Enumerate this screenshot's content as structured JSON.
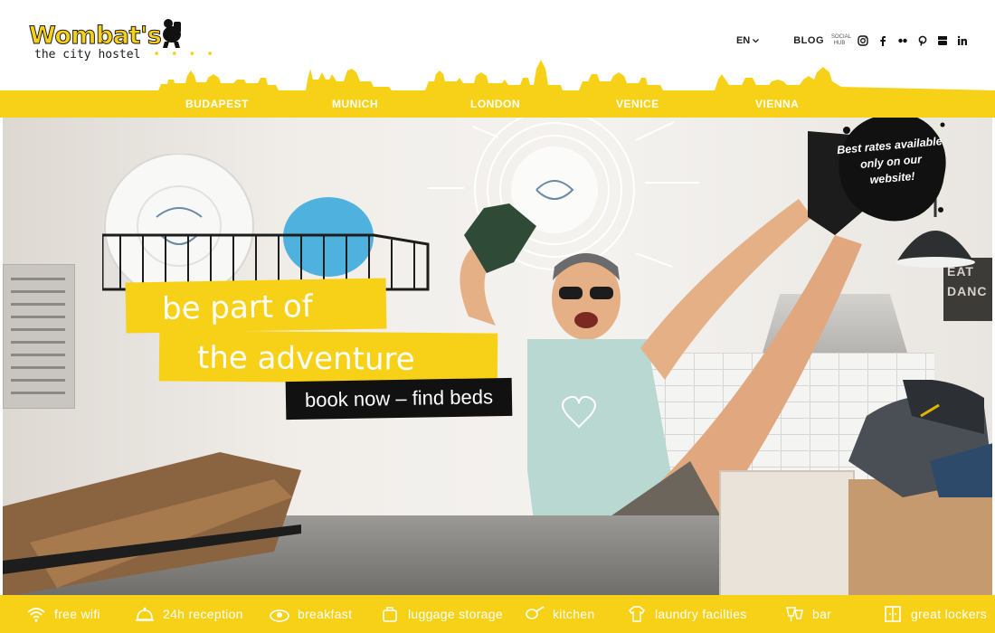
{
  "brand": {
    "logo_main": "Wombat's",
    "logo_sub": "the city hostel",
    "logo_dots": "• • • •"
  },
  "topnav": {
    "language": "EN",
    "blog_label": "BLOG",
    "social_hub": "SOCIAL HUB",
    "social_icons": [
      "instagram-icon",
      "facebook-icon",
      "flickr-icon",
      "pinterest-icon",
      "youtube-icon",
      "linkedin-icon"
    ]
  },
  "cities": [
    "BUDAPEST",
    "MUNICH",
    "LONDON",
    "VENICE",
    "VIENNA"
  ],
  "hero": {
    "headline_line1": "be part of",
    "headline_line2": "the adventure",
    "cta_label": "book now – find beds",
    "badge_text": "Best rates available only on our website!",
    "sign_text_1": "EAT",
    "sign_text_2": "DANC"
  },
  "amenities": [
    {
      "label": "free wifi",
      "icon": "wifi-icon"
    },
    {
      "label": "24h reception",
      "icon": "reception-bell-icon"
    },
    {
      "label": "breakfast",
      "icon": "breakfast-icon"
    },
    {
      "label": "luggage storage",
      "icon": "luggage-icon"
    },
    {
      "label": "kitchen",
      "icon": "kitchen-icon"
    },
    {
      "label": "laundry facilties",
      "icon": "laundry-icon"
    },
    {
      "label": "bar",
      "icon": "bar-icon"
    },
    {
      "label": "great lockers",
      "icon": "locker-icon"
    }
  ],
  "colors": {
    "brand_yellow": "#f7d117",
    "dark": "#111111",
    "white": "#ffffff"
  }
}
